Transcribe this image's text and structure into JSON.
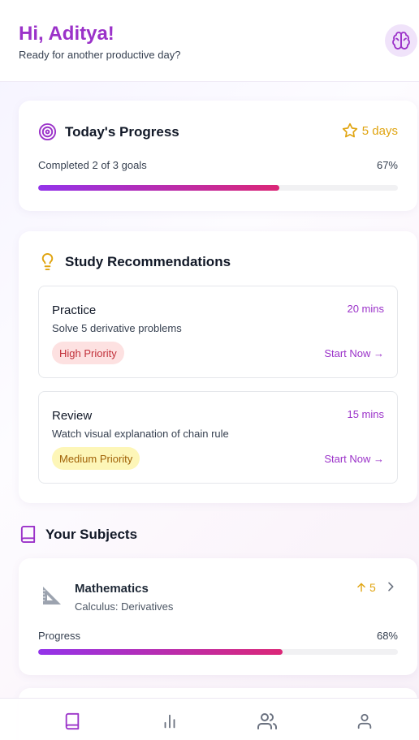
{
  "header": {
    "greeting": "Hi, Aditya!",
    "subtitle": "Ready for another productive day?",
    "brain_icon": "brain-icon"
  },
  "progress": {
    "title": "Today's Progress",
    "streak_label": "5 days",
    "completed_label": "Completed 2 of 3 goals",
    "percent_label": "67%",
    "fraction": 0.67
  },
  "recommendations": {
    "title": "Study Recommendations",
    "items": [
      {
        "type": "Practice",
        "description": "Solve 5 derivative problems",
        "duration": "20 mins",
        "priority": "High Priority",
        "action": "Start Now →"
      },
      {
        "type": "Review",
        "description": "Watch visual explanation of chain rule",
        "duration": "15 mins",
        "priority": "Medium Priority",
        "action": "Start Now →"
      }
    ]
  },
  "subjects": {
    "title": "Your Subjects",
    "items": [
      {
        "name": "Mathematics",
        "topic": "Calculus: Derivatives",
        "trend": "5",
        "progress_label": "Progress",
        "percent_label": "68%",
        "fraction": 0.68
      }
    ]
  },
  "colors": {
    "accent": "#9b32c9",
    "gold": "#e0a410",
    "gradient_start": "#9333ea",
    "gradient_end": "#db2777"
  },
  "nav": {
    "items": [
      "book-icon",
      "bar-chart-icon",
      "users-icon",
      "user-icon"
    ],
    "active": "book-icon"
  }
}
